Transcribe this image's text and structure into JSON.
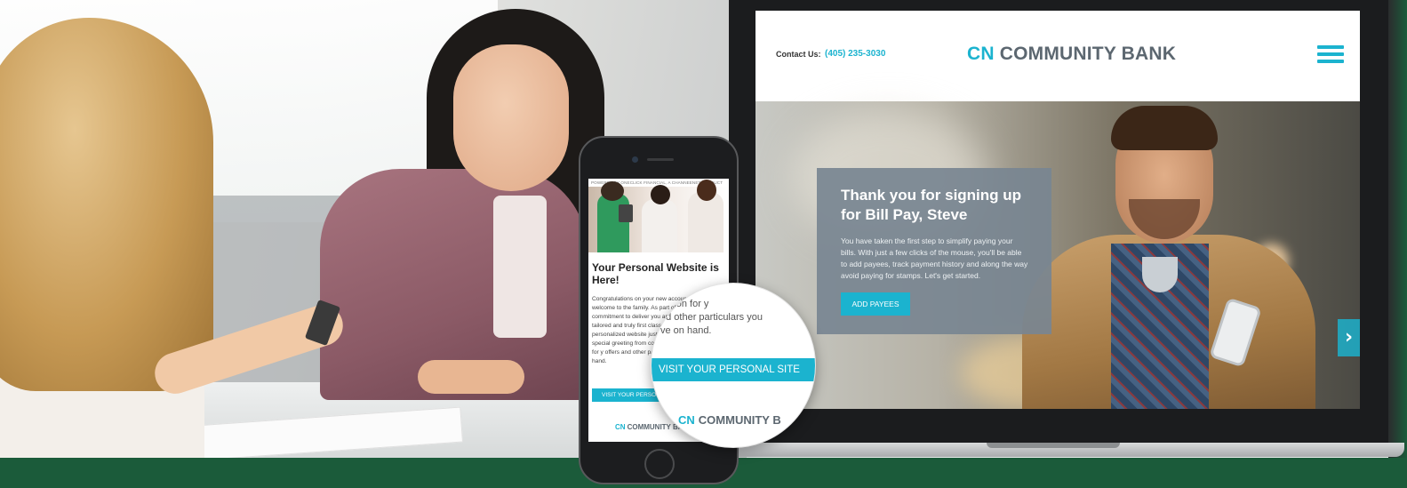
{
  "laptop_site": {
    "contact_label": "Contact Us:",
    "contact_phone": "(405) 235-3030",
    "brand_prefix": "CN",
    "brand_name": "COMMUNITY BANK",
    "menu_icon": "hamburger-icon",
    "promo": {
      "title": "Thank you for signing up for Bill Pay, Steve",
      "body": "You have taken the first step to simplify paying your bills. With just a few clicks of the mouse, you'll be able to add payees, track payment history and along the way avoid paying for stamps. Let's get started.",
      "button": "ADD PAYEES"
    },
    "prev_arrow": "‹",
    "next_arrow": "›"
  },
  "phone_site": {
    "powered_by": "POWERED BY ONECLICK FINANCIAL, A CHANNEENET PRODUCT",
    "title": "Your Personal Website is Here!",
    "body": "Congratulations on your new account and welcome to the family. As part of our commitment to deliver you an expe tailored and truly first class, we' personalized website just for y for a special greeting from contact information for y offers and other particu to have on hand.",
    "button": "VISIT YOUR PERSONAL SITE",
    "brand_prefix": "CN",
    "brand_name": "COMMUNITY BANK"
  },
  "magnifier": {
    "line1": "nation for y",
    "line2": "nd other particulars you",
    "line3": "ve on hand.",
    "button": "VISIT YOUR PERSONAL SITE",
    "brand_prefix": "CN",
    "brand_name": "COMMUNITY B"
  },
  "colors": {
    "accent": "#1bb3cf",
    "brand_gray": "#5c6770",
    "promo_panel": "#788591",
    "footer_green": "#1b5b3a"
  }
}
